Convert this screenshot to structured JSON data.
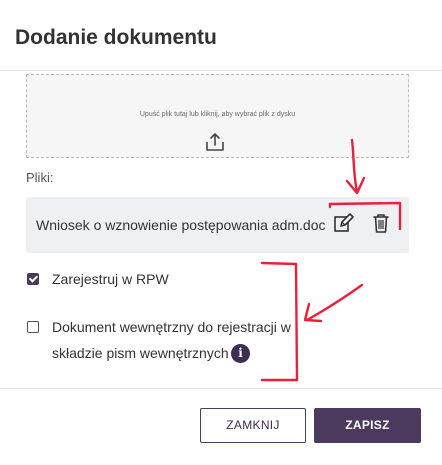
{
  "dialog": {
    "title": "Dodanie dokumentu"
  },
  "dropzone": {
    "hint": "Upuść plik tutaj lub kliknij, aby wybrać plik z dysku",
    "icon": "upload-icon"
  },
  "files": {
    "label": "Pliki:",
    "items": [
      {
        "name": "Wniosek o wznowienie postępowania adm.doc"
      }
    ]
  },
  "options": {
    "register_rpw": {
      "label": "Zarejestruj w RPW",
      "checked": true
    },
    "internal_document": {
      "label_line1": "Dokument wewnętrzny do rejestracji w",
      "label_line2": "składzie pism wewnętrznych",
      "checked": false
    },
    "info_glyph": "i"
  },
  "buttons": {
    "close_label": "ZAMKNIJ",
    "save_label": "ZAPISZ"
  },
  "colors": {
    "primary": "#4b3a5e",
    "annotation": "#e8223a",
    "file_row_bg": "#eef0f3"
  }
}
